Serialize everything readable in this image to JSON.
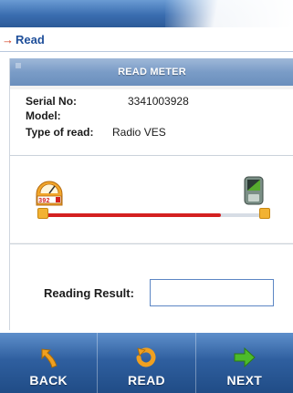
{
  "breadcrumb": {
    "arrow": "→",
    "label": "Read"
  },
  "panel": {
    "title": "READ METER",
    "serial_label": "Serial No:",
    "serial_value": "3341003928",
    "model_label": "Model:",
    "model_value": "",
    "type_label": "Type of read:",
    "type_value": "Radio VES",
    "gauge_digits": "392",
    "progress": 0.8,
    "reading_label": "Reading Result:",
    "reading_value": ""
  },
  "bottom_nav": {
    "back_label": "BACK",
    "read_label": "READ",
    "next_label": "NEXT"
  },
  "icons": {
    "back": "back-arrow-icon",
    "read": "refresh-icon",
    "next": "next-arrow-icon",
    "meter": "meter-gauge-icon",
    "handheld": "handheld-device-icon"
  },
  "colors": {
    "accent": "#2f5f9f",
    "progress_fill": "#d42020",
    "icon_orange": "#f0a020",
    "icon_green": "#4cbb2a"
  }
}
